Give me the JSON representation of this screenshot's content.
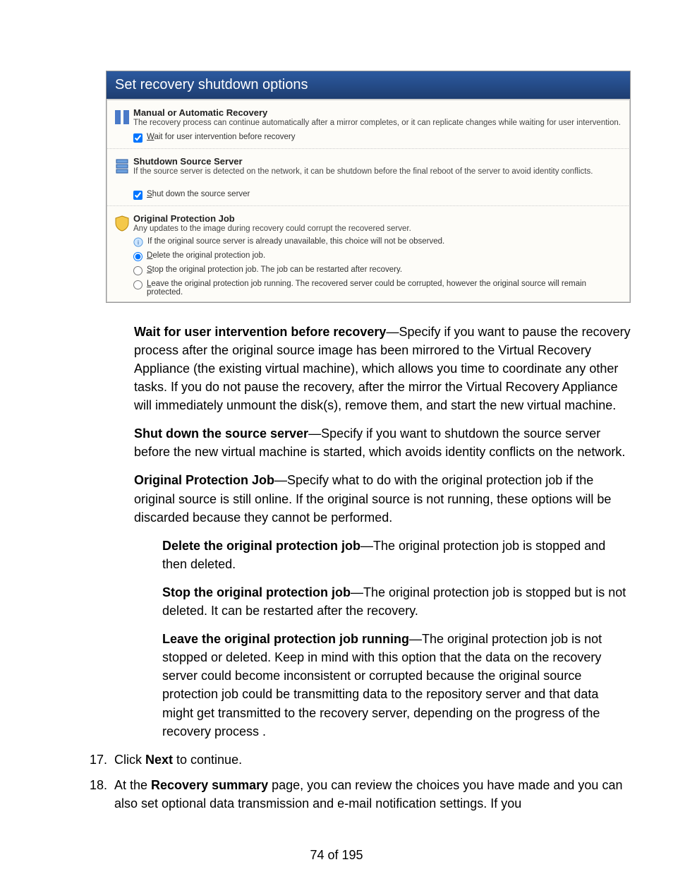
{
  "dialog": {
    "title": "Set recovery shutdown options",
    "sections": {
      "manual": {
        "title": "Manual or Automatic Recovery",
        "desc": "The recovery process can continue automatically after a mirror completes, or it can replicate changes while waiting for user intervention.",
        "checkbox_label": "Wait for user intervention before recovery",
        "checkbox_checked": true
      },
      "shutdown": {
        "title": "Shutdown Source Server",
        "desc": "If the source server is detected on the network, it can be shutdown before the final reboot of the server to avoid identity conflicts.",
        "checkbox_label": "Shut down the source server",
        "checkbox_checked": true
      },
      "original": {
        "title": "Original Protection Job",
        "desc": "Any updates to the image during recovery could corrupt the recovered server.",
        "hint": "If the original source server is already unavailable, this choice will not be observed.",
        "radio1": "Delete the original protection job.",
        "radio2": "Stop the original protection job. The job can be restarted after recovery.",
        "radio3": "Leave the original protection job running. The recovered server could be corrupted, however the original source will remain protected.",
        "radio_selected": 1
      }
    }
  },
  "explain": {
    "wait_title": "Wait for user intervention before recovery",
    "wait_body": "—Specify if you want to pause the recovery process after the original source image has been mirrored to the Virtual Recovery Appliance (the existing virtual machine), which allows you time to coordinate any other tasks. If you do not pause the recovery, after the mirror the Virtual Recovery Appliance will immediately unmount the disk(s), remove them, and start the new virtual machine.",
    "shutdown_title": "Shut down the source server",
    "shutdown_body": "—Specify if you want to shutdown the source server before the new virtual machine is started, which avoids identity conflicts on the network.",
    "orig_title": "Original Protection Job",
    "orig_body": "—Specify what to do with the original protection job if the original source is still online. If the original source is not running, these options will be discarded because they cannot be performed.",
    "delete_title": "Delete the original protection job",
    "delete_body": "—The original protection job is stopped and then deleted.",
    "stop_title": "Stop the original protection job",
    "stop_body": "—The original protection job is stopped but is not deleted. It can be restarted after the recovery.",
    "leave_title": "Leave the original protection job running",
    "leave_body": "—The original protection job is not stopped or deleted. Keep in mind with this option that the data on the recovery server could become inconsistent or corrupted because the original source protection job could be transmitting data to the repository server and that data might get transmitted to the recovery server, depending on the progress of the recovery process ."
  },
  "steps": {
    "s17_num": "17.",
    "s17_a": "Click ",
    "s17_b": "Next",
    "s17_c": " to continue.",
    "s18_num": "18.",
    "s18_a": "At the ",
    "s18_b": "Recovery summary",
    "s18_c": " page, you can review the choices you have made and you can also set optional data transmission and e-mail notification settings. If you"
  },
  "footer": {
    "page": "74 of 195"
  }
}
